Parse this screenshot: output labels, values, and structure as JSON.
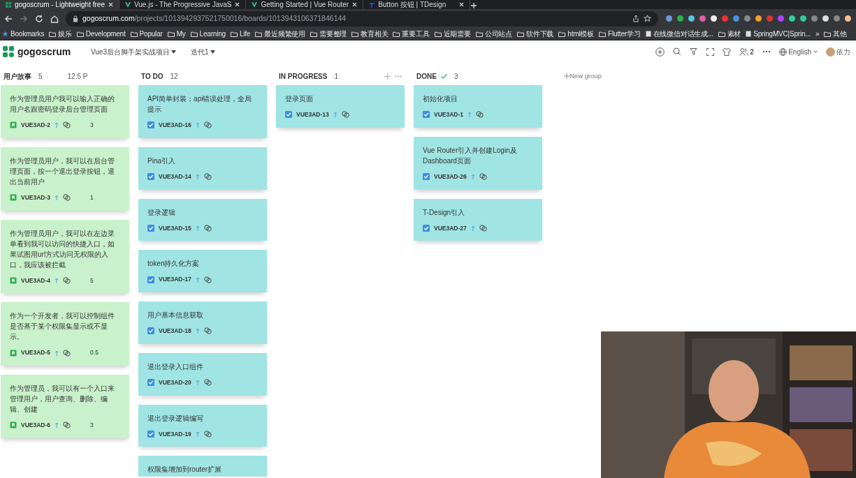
{
  "browser": {
    "tabs": [
      {
        "title": "gogoscrum - Lightweight free",
        "selected": true
      },
      {
        "title": "Vue.js - The Progressive JavaS",
        "selected": false
      },
      {
        "title": "Getting Started | Vue Router",
        "selected": false
      },
      {
        "title": "Button 按钮 | TDesign",
        "selected": false
      }
    ],
    "url_host": "gogoscrum.com",
    "url_path": "/projects/1013942937521750016/boards/1013943106371846144",
    "bookmarks": [
      {
        "label": "Bookmarks",
        "kind": "star"
      },
      {
        "label": "娱乐",
        "kind": "folder"
      },
      {
        "label": "Development",
        "kind": "folder"
      },
      {
        "label": "Popular",
        "kind": "folder"
      },
      {
        "label": "My",
        "kind": "folder"
      },
      {
        "label": "Learning",
        "kind": "folder"
      },
      {
        "label": "Life",
        "kind": "folder"
      },
      {
        "label": "最近频繁使用",
        "kind": "folder"
      },
      {
        "label": "需要整理",
        "kind": "folder"
      },
      {
        "label": "教育相关",
        "kind": "folder"
      },
      {
        "label": "重要工具",
        "kind": "folder"
      },
      {
        "label": "近期需要",
        "kind": "folder"
      },
      {
        "label": "公司站点",
        "kind": "folder"
      },
      {
        "label": "软件下载",
        "kind": "folder"
      },
      {
        "label": "html模板",
        "kind": "folder"
      },
      {
        "label": "Flutter学习",
        "kind": "folder"
      },
      {
        "label": "在线微信对话生成...",
        "kind": "page"
      },
      {
        "label": "素材",
        "kind": "folder"
      },
      {
        "label": "SpringMVC|Sprin...",
        "kind": "page"
      },
      {
        "label": "»",
        "kind": "more"
      },
      {
        "label": "其他",
        "kind": "folder"
      }
    ]
  },
  "app": {
    "logo": "gogoscrum",
    "project": "Vue3后台脚手架实战项目",
    "sprint": "迭代1",
    "member_count": "2",
    "language": "English",
    "user": "依力",
    "new_group": "New group"
  },
  "columns": [
    {
      "name": "用户故事",
      "count": "5",
      "points": "12.5 P",
      "complete": false,
      "show_actions": false,
      "cards": [
        {
          "kind": "story",
          "title": "作为管理员用户我可以输入正确的用户名跟密码登录后台管理页面",
          "id": "VUE3AD-2",
          "points": "3"
        },
        {
          "kind": "story",
          "title": "作为管理员用户，我可以在后台管理页面，按一个退出登录按钮，退出当前用户",
          "id": "VUE3AD-3",
          "points": "1"
        },
        {
          "kind": "story",
          "title": "作为管理员用户，我可以在左边菜单看到我可以访问的快捷入口，如果试图用url方式访问无权限的入口，我应该被拦截",
          "id": "VUE3AD-4",
          "points": "5"
        },
        {
          "kind": "story",
          "title": "作为一个开发者，我可以控制组件是否基于某个权限集显示或不显示。",
          "id": "VUE3AD-5",
          "points": "0.5"
        },
        {
          "kind": "story",
          "title": "作为管理员，我可以有一个入口来管理用户，用户查询、删除、编辑、创建",
          "id": "VUE3AD-6",
          "points": "3"
        }
      ]
    },
    {
      "name": "TO DO",
      "count": "12",
      "complete": false,
      "show_actions": false,
      "cards": [
        {
          "kind": "task",
          "title": "API简单封装；api错误处理，全局提示",
          "id": "VUE3AD-16",
          "checked": true
        },
        {
          "kind": "task",
          "title": "Pina引入",
          "id": "VUE3AD-14",
          "checked": true
        },
        {
          "kind": "task",
          "title": "登录逻辑",
          "id": "VUE3AD-15",
          "checked": true
        },
        {
          "kind": "task",
          "title": "token持久化方案",
          "id": "VUE3AD-17",
          "checked": true
        },
        {
          "kind": "task",
          "title": "用户基本信息获取",
          "id": "VUE3AD-18",
          "checked": true
        },
        {
          "kind": "task",
          "title": "退出登录入口组件",
          "id": "VUE3AD-20",
          "checked": true
        },
        {
          "kind": "task",
          "title": "退出登录逻辑编写",
          "id": "VUE3AD-19",
          "checked": true
        },
        {
          "kind": "task",
          "title": "权限集增加到router扩展"
        }
      ]
    },
    {
      "name": "IN PROGRESS",
      "count": "1",
      "complete": false,
      "show_actions": true,
      "cards": [
        {
          "kind": "task",
          "title": "登录页面",
          "id": "VUE3AD-13",
          "checked": true
        }
      ]
    },
    {
      "name": "DONE",
      "count": "3",
      "complete": true,
      "show_actions": false,
      "cards": [
        {
          "kind": "task",
          "title": "初始化项目",
          "id": "VUE3AD-1",
          "checked": true
        },
        {
          "kind": "task",
          "title": "Vue Router引入并创建Login及Dashboard页面",
          "id": "VUE3AD-26",
          "checked": true
        },
        {
          "kind": "task",
          "title": "T-Design引入",
          "id": "VUE3AD-27",
          "checked": true
        }
      ]
    }
  ]
}
